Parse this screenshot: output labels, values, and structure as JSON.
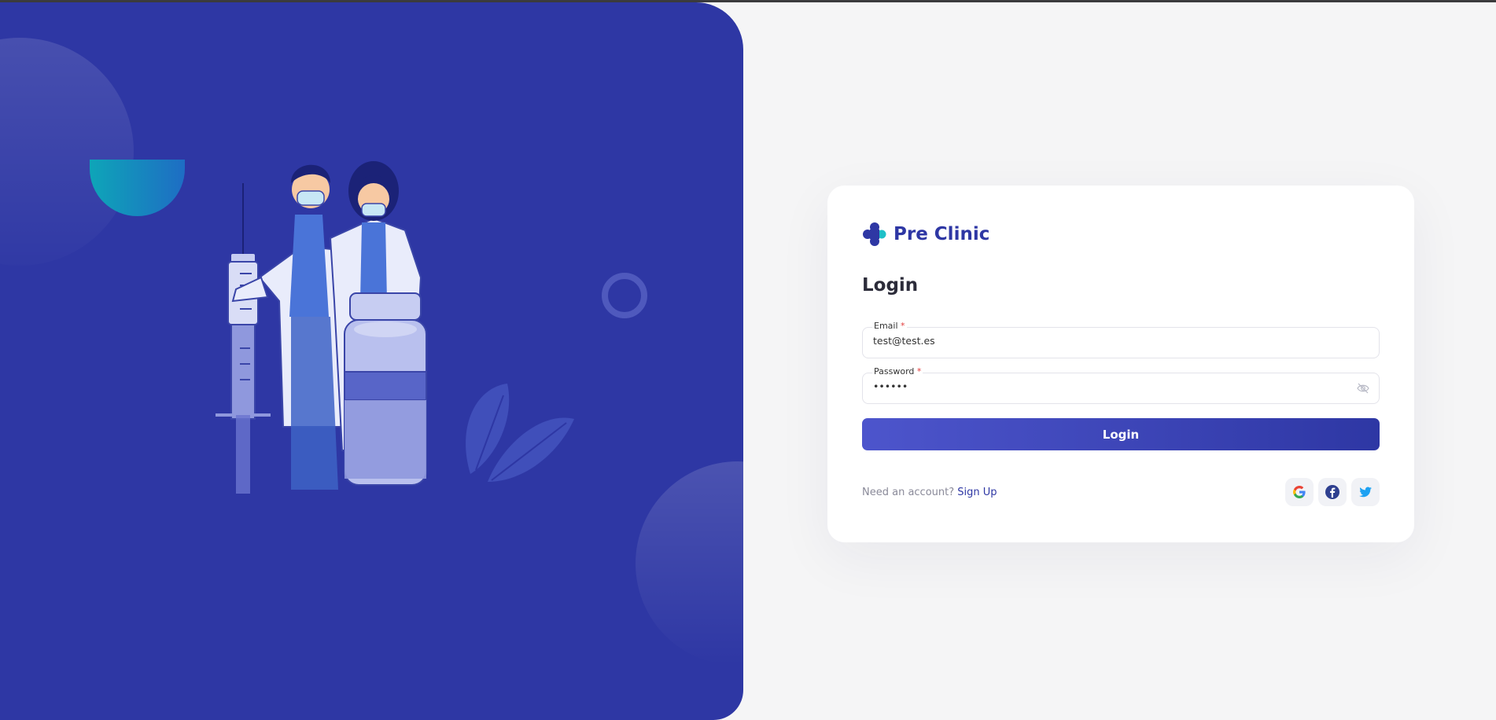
{
  "brand": {
    "name": "Pre Clinic"
  },
  "form": {
    "title": "Login",
    "email": {
      "label": "Email",
      "required_mark": "*",
      "value": "test@test.es"
    },
    "password": {
      "label": "Password",
      "required_mark": "*",
      "value": "••••••"
    },
    "submit_label": "Login"
  },
  "signup": {
    "prompt": "Need an account?",
    "link_label": "Sign Up"
  },
  "social": [
    {
      "icon": "google-icon"
    },
    {
      "icon": "facebook-icon"
    },
    {
      "icon": "twitter-icon"
    }
  ],
  "colors": {
    "primary": "#2e37a4",
    "accent": "#1ec0c8",
    "page_background": "#f5f5f6",
    "required": "#e23b3b"
  }
}
